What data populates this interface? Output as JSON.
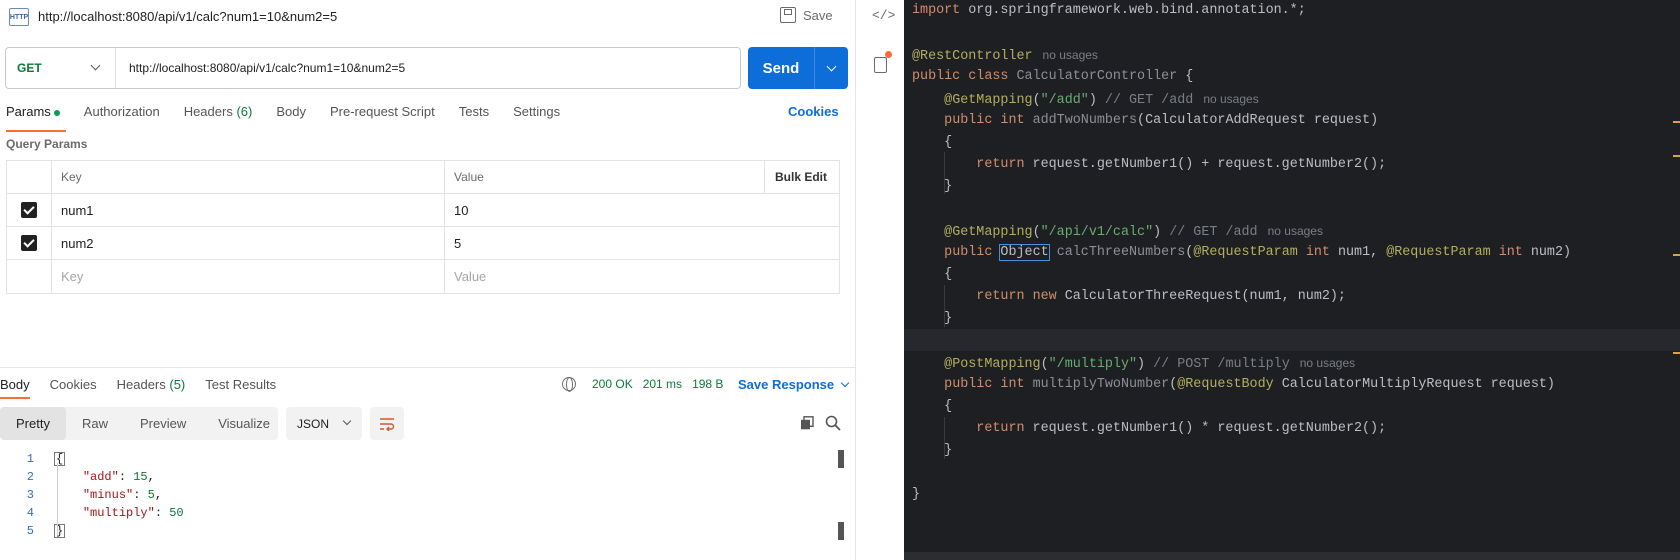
{
  "postman": {
    "tab_title": "http://localhost:8080/api/v1/calc?num1=10&num2=5",
    "tab_icon_label": "HTTP",
    "save_label": "Save",
    "method": "GET",
    "url": "http://localhost:8080/api/v1/calc?num1=10&num2=5",
    "send_label": "Send",
    "request_tabs": {
      "params": "Params",
      "authorization": "Authorization",
      "headers": "Headers",
      "headers_count": "(6)",
      "body": "Body",
      "prerequest": "Pre-request Script",
      "tests": "Tests",
      "settings": "Settings"
    },
    "cookies_label": "Cookies",
    "query_params_title": "Query Params",
    "table": {
      "key_header": "Key",
      "value_header": "Value",
      "bulk_edit": "Bulk Edit",
      "rows": [
        {
          "key": "num1",
          "value": "10",
          "checked": true
        },
        {
          "key": "num2",
          "value": "5",
          "checked": true
        }
      ],
      "key_placeholder": "Key",
      "value_placeholder": "Value"
    },
    "response_tabs": {
      "body": "Body",
      "cookies": "Cookies",
      "headers": "Headers",
      "headers_count": "(5)",
      "test_results": "Test Results"
    },
    "status": {
      "code": "200 OK",
      "time": "201 ms",
      "size": "198 B"
    },
    "save_response_label": "Save Response",
    "view_modes": [
      "Pretty",
      "Raw",
      "Preview",
      "Visualize"
    ],
    "format": "JSON",
    "response_lines": [
      {
        "n": "1",
        "text": "{"
      },
      {
        "n": "2",
        "key": "\"add\"",
        "value": "15",
        "trail": ","
      },
      {
        "n": "3",
        "key": "\"minus\"",
        "value": "5",
        "trail": ","
      },
      {
        "n": "4",
        "key": "\"multiply\"",
        "value": "50",
        "trail": ""
      },
      {
        "n": "5",
        "text": "}"
      }
    ]
  },
  "strip": {
    "code_toggle": "</>"
  },
  "ide": {
    "import_kw": "import",
    "import_rest": " org.springframework.web.bind.annotation.*;",
    "rest_controller": "@RestController",
    "no_usages": "no usages",
    "public": "public",
    "class": "class",
    "class_name": "CalculatorController",
    "open_brace": " {",
    "get_mapping": "@GetMapping",
    "add_path": "\"/add\"",
    "add_comment": "// GET /add",
    "int": "int",
    "add_method": "addTwoNumbers",
    "add_params": "(CalculatorAddRequest request)",
    "lbrace": "{",
    "rbrace": "}",
    "return": "return",
    "add_expr": " request.getNumber1() + request.getNumber2();",
    "calc_path": "\"/api/v1/calc\"",
    "calc_comment": "// GET /add",
    "object_type": "Object",
    "calc_method": "calcThreeNumbers",
    "request_param": "@RequestParam",
    "num1": " num1, ",
    "num2": " num2)",
    "new": "new",
    "calc_expr": " CalculatorThreeRequest(num1, num2);",
    "post_mapping": "@PostMapping",
    "multiply_path": "\"/multiply\"",
    "multiply_comment": "// POST /multiply",
    "multiply_method": "multiplyTwoNumber",
    "request_body": "@RequestBody",
    "multiply_params": " CalculatorMultiplyRequest request)",
    "multiply_expr": " request.getNumber1() * request.getNumber2();"
  },
  "colors": {
    "send_blue": "#0d6ed9",
    "method_green": "#0b7a38",
    "accent_orange": "#ff6c37",
    "ide_bg": "#1e1f22"
  }
}
